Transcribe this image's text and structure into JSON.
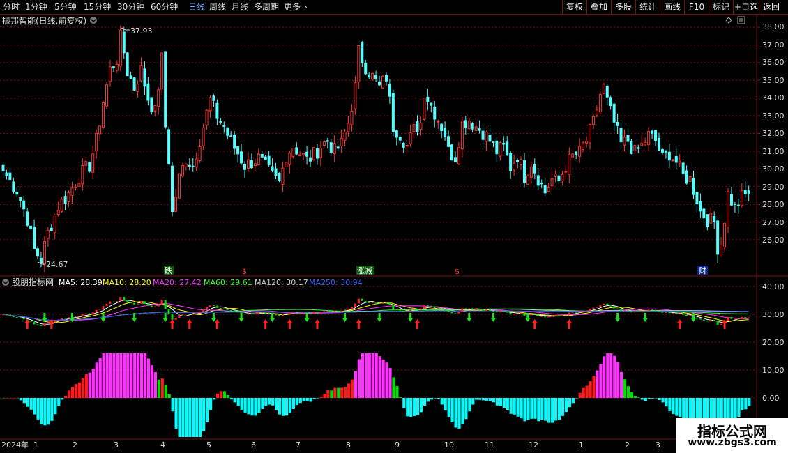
{
  "toolbar": {
    "periods": [
      "分时",
      "1分钟",
      "5分钟",
      "15分钟",
      "30分钟",
      "60分钟",
      "日线",
      "周线",
      "月线",
      "多周期",
      "更多"
    ],
    "active_period": "日线",
    "more_arrow": "chevron-right-icon",
    "right_buttons": [
      "复权",
      "叠加",
      "多股",
      "统计",
      "画线",
      "F10",
      "标记",
      "+自选",
      "返回"
    ]
  },
  "main_panel": {
    "title": "振邦智能(日线,前复权)",
    "title_dropdown_icon": "circle-chevron-down-icon",
    "diamond_icon": "diamond-icon",
    "menu_icon": "menu-icon",
    "high_label": "37.93",
    "low_label": "24.67",
    "y_ticks": [
      "38.00",
      "37.00",
      "36.00",
      "35.00",
      "34.00",
      "33.00",
      "32.00",
      "31.00",
      "30.00",
      "29.00",
      "28.00",
      "27.00",
      "26.00"
    ],
    "markers": [
      "跌",
      "$",
      "涨减",
      "$",
      "财"
    ]
  },
  "indicator_panel": {
    "name": "股朋指标网",
    "ma": [
      {
        "label": "MA5: 28.39",
        "color": "#ffffff"
      },
      {
        "label": "MA10: 28.20",
        "color": "#ffff00"
      },
      {
        "label": "MA20: 27.42",
        "color": "#ff33ff"
      },
      {
        "label": "MA60: 29.61",
        "color": "#33ff33"
      },
      {
        "label": "MA120: 30.17",
        "color": "#cccccc"
      },
      {
        "label": "MA250: 30.94",
        "color": "#2255ff"
      }
    ],
    "y_ticks": [
      "40.00",
      "30.00",
      "20.00",
      "10.00",
      "0.00"
    ]
  },
  "x_axis": {
    "year_label": "2024年",
    "months": [
      "1",
      "2",
      "3",
      "4",
      "5",
      "6",
      "7",
      "8",
      "9",
      "10",
      "11",
      "12",
      "1",
      "2",
      "3"
    ]
  },
  "watermark": {
    "line1": "指标公式网",
    "line2": "www.zbgs3.com"
  },
  "colors": {
    "up": "#ff3333",
    "down": "#54ffff",
    "grid": "#7a1010",
    "axis_text": "#dddddd",
    "bar_magenta": "#ff33ff",
    "bar_green": "#00e000",
    "bar_red": "#ff1a1a",
    "bar_cyan": "#00ffff"
  },
  "chart_data": {
    "type": "candlestick",
    "price_range": [
      24.67,
      37.93
    ],
    "close_path": [
      [
        0,
        29.9
      ],
      [
        4,
        28.8
      ],
      [
        7,
        27.2
      ],
      [
        9,
        25.4
      ],
      [
        11,
        24.9
      ],
      [
        13,
        26.4
      ],
      [
        16,
        27.9
      ],
      [
        19,
        28.6
      ],
      [
        22,
        29.6
      ],
      [
        25,
        30.2
      ],
      [
        27,
        31.6
      ],
      [
        29,
        33.8
      ],
      [
        31,
        35.6
      ],
      [
        33,
        36.2
      ],
      [
        34,
        37.4
      ],
      [
        35,
        36.6
      ],
      [
        36,
        35.5
      ],
      [
        38,
        34.6
      ],
      [
        40,
        35.6
      ],
      [
        42,
        34.0
      ],
      [
        44,
        33.2
      ],
      [
        46,
        36.2
      ],
      [
        47,
        32.4
      ],
      [
        48,
        30.5
      ],
      [
        49,
        27.5
      ],
      [
        51,
        29.5
      ],
      [
        53,
        30.6
      ],
      [
        55,
        30.2
      ],
      [
        58,
        32.4
      ],
      [
        60,
        33.9
      ],
      [
        62,
        33.0
      ],
      [
        64,
        32.4
      ],
      [
        66,
        31.5
      ],
      [
        68,
        30.9
      ],
      [
        70,
        30.2
      ],
      [
        72,
        30.4
      ],
      [
        74,
        30.6
      ],
      [
        76,
        30.1
      ],
      [
        78,
        29.6
      ],
      [
        80,
        29.2
      ],
      [
        82,
        30.8
      ],
      [
        84,
        31.3
      ],
      [
        86,
        30.9
      ],
      [
        88,
        30.5
      ],
      [
        90,
        30.8
      ],
      [
        92,
        31.3
      ],
      [
        94,
        31.6
      ],
      [
        96,
        31.0
      ],
      [
        98,
        31.4
      ],
      [
        100,
        32.6
      ],
      [
        102,
        34.6
      ],
      [
        103,
        36.6
      ],
      [
        105,
        35.8
      ],
      [
        107,
        35.2
      ],
      [
        109,
        34.6
      ],
      [
        111,
        35.2
      ],
      [
        113,
        32.4
      ],
      [
        115,
        32.0
      ],
      [
        117,
        31.3
      ],
      [
        119,
        32.2
      ],
      [
        121,
        32.6
      ],
      [
        122,
        34.4
      ],
      [
        124,
        33.6
      ],
      [
        126,
        32.8
      ],
      [
        128,
        32.0
      ],
      [
        129,
        31.0
      ],
      [
        131,
        30.7
      ],
      [
        133,
        32.6
      ],
      [
        135,
        32.8
      ],
      [
        137,
        32.4
      ],
      [
        139,
        32.1
      ],
      [
        141,
        31.6
      ],
      [
        143,
        31.0
      ],
      [
        145,
        31.2
      ],
      [
        147,
        30.1
      ],
      [
        149,
        30.8
      ],
      [
        151,
        29.6
      ],
      [
        153,
        30.4
      ],
      [
        155,
        29.5
      ],
      [
        157,
        28.7
      ],
      [
        159,
        29.4
      ],
      [
        161,
        29.3
      ],
      [
        163,
        30.2
      ],
      [
        165,
        30.7
      ],
      [
        167,
        30.9
      ],
      [
        169,
        31.6
      ],
      [
        171,
        32.6
      ],
      [
        173,
        34.2
      ],
      [
        174,
        34.6
      ],
      [
        175,
        33.8
      ],
      [
        177,
        32.6
      ],
      [
        179,
        31.4
      ],
      [
        181,
        31.6
      ],
      [
        183,
        30.9
      ],
      [
        185,
        31.3
      ],
      [
        187,
        31.9
      ],
      [
        189,
        31.6
      ],
      [
        191,
        30.6
      ],
      [
        193,
        30.9
      ],
      [
        195,
        30.4
      ],
      [
        197,
        29.6
      ],
      [
        199,
        29.4
      ],
      [
        201,
        28.3
      ],
      [
        202,
        27.6
      ],
      [
        204,
        27.2
      ],
      [
        206,
        27.0
      ],
      [
        207,
        25.6
      ],
      [
        208,
        25.8
      ],
      [
        210,
        28.6
      ],
      [
        212,
        27.8
      ],
      [
        214,
        28.4
      ],
      [
        216,
        28.6
      ]
    ],
    "ma_lines": [
      "MA5",
      "MA10",
      "MA20",
      "MA60",
      "MA120",
      "MA250"
    ],
    "histogram_range": [
      -14,
      16
    ]
  }
}
